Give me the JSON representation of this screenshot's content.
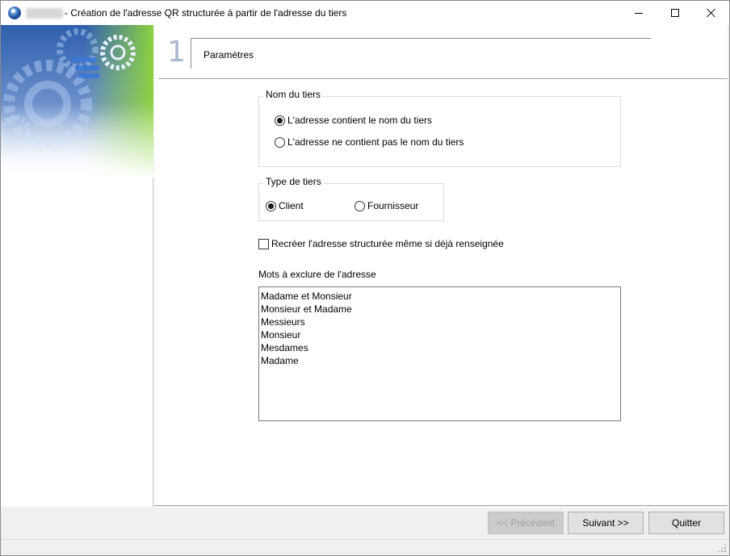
{
  "window": {
    "title": "- Création de l'adresse QR structurée à partir de l'adresse du tiers",
    "app_icon": "app-globe-icon",
    "controls": {
      "minimize": "minimize-icon",
      "maximize": "maximize-icon",
      "close": "close-icon"
    }
  },
  "step": {
    "number": "1",
    "title": "Paramètres"
  },
  "nom_du_tiers": {
    "legend": "Nom du tiers",
    "options": [
      {
        "label": "L'adresse contient le nom du tiers",
        "selected": true
      },
      {
        "label": "L'adresse ne contient pas le nom du tiers",
        "selected": false
      }
    ]
  },
  "type_de_tiers": {
    "legend": "Type de tiers",
    "options": [
      {
        "label": "Client",
        "selected": true
      },
      {
        "label": "Fournisseur",
        "selected": false
      }
    ]
  },
  "recreate_checkbox": {
    "label": "Recréer l'adresse structurée même si déjà renseignée",
    "checked": false
  },
  "excluded_words": {
    "label": "Mots à exclure de l'adresse",
    "lines": [
      "Madame et Monsieur",
      "Monsieur et Madame",
      "Messieurs",
      "Monsieur",
      "Mesdames",
      "Madame"
    ]
  },
  "buttons": {
    "previous": "<< Précédent",
    "next": "Suivant >>",
    "quit": "Quitter"
  },
  "colors": {
    "banner_blue": "#2f5fae",
    "banner_green": "#8fd63a",
    "step_number": "#a8b8cc"
  }
}
